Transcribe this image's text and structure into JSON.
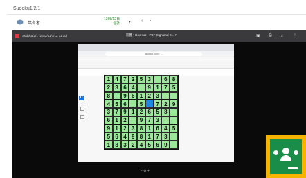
{
  "header": {
    "title": "Sudoku1/2/1"
  },
  "user": {
    "name": "共有者",
    "views_line1": "1365/12日",
    "views_line2": "合計",
    "dropdown": "▾"
  },
  "nav": {
    "prev": "‹",
    "next": "›"
  },
  "video": {
    "file_label": "Sudoku/2/1 (2022/11/7/12 11:30)",
    "tab_label": "影響 * DocHub - PDF Sign and E... ✕",
    "url": "dochub.com › ...",
    "zoom_controls": "− ⊕ +"
  },
  "sudoku": {
    "rows": [
      [
        "1",
        "4",
        "7",
        "2",
        "5",
        "3",
        "",
        "6",
        "8"
      ],
      [
        "2",
        "3",
        "6",
        "4",
        "",
        "9",
        "1",
        "7",
        "5"
      ],
      [
        "8",
        "",
        "9",
        "6",
        "1",
        "2",
        "3",
        "",
        ""
      ],
      [
        "4",
        "5",
        "6",
        "",
        "5",
        "",
        "7",
        "2",
        "9"
      ],
      [
        "3",
        "7",
        "9",
        "1",
        "2",
        "6",
        "5",
        "8",
        ""
      ],
      [
        "6",
        "1",
        "2",
        "",
        "9",
        "7",
        "3",
        "",
        ""
      ],
      [
        "9",
        "1",
        "2",
        "3",
        "8",
        "1",
        "6",
        "4",
        "5"
      ],
      [
        "5",
        "6",
        "4",
        "9",
        "8",
        "1",
        "7",
        "3",
        ""
      ],
      [
        "1",
        "8",
        "3",
        "2",
        "4",
        "5",
        "6",
        "9",
        ""
      ]
    ],
    "selected": [
      3,
      5
    ]
  },
  "colors": {
    "grid_green": "#9be89b",
    "select_blue": "#1e88e5",
    "classroom_yellow": "#f6b400",
    "classroom_green": "#1a8d49"
  }
}
